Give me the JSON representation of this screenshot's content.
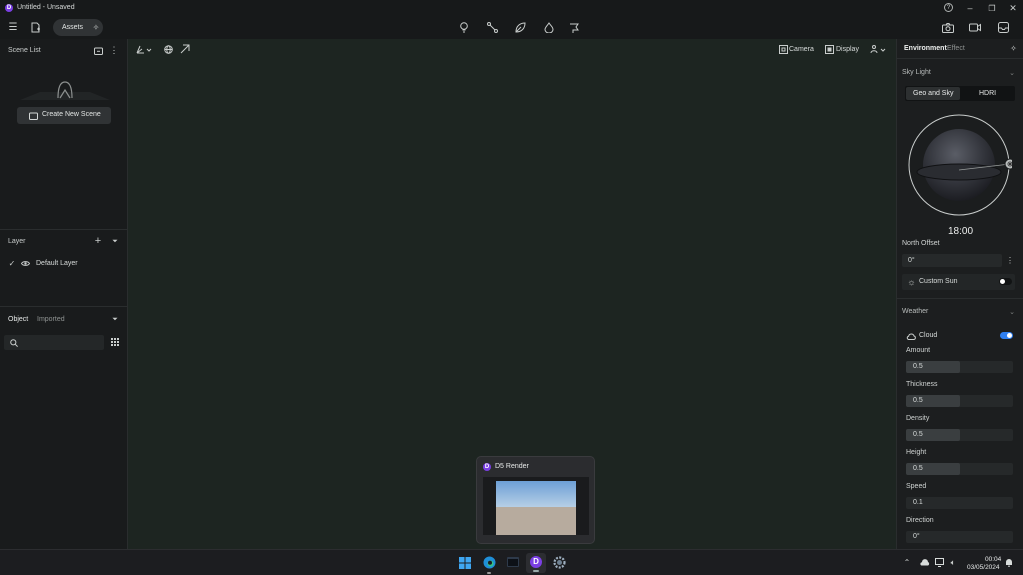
{
  "window": {
    "title": "Untitled - Unsaved"
  },
  "toolbar": {
    "assets_label": "Assets"
  },
  "scene_list": {
    "title": "Scene List",
    "create_button": "Create New Scene"
  },
  "layer": {
    "title": "Layer",
    "items": [
      {
        "label": "Default Layer"
      }
    ]
  },
  "object_panel": {
    "tabs": [
      "Object",
      "Imported"
    ],
    "search_placeholder": ""
  },
  "viewport_bar": {
    "camera_label": "Camera",
    "display_label": "Display"
  },
  "right_panel": {
    "tabs": [
      "Environment",
      "Effect"
    ],
    "sky_light": {
      "title": "Sky Light",
      "modes": [
        "Geo and Sky",
        "HDRI"
      ],
      "time": "18:00",
      "north_offset_label": "North Offset",
      "north_offset_value": "0°",
      "custom_sun_label": "Custom Sun",
      "custom_sun_enabled": false
    },
    "weather": {
      "title": "Weather",
      "cloud_label": "Cloud",
      "cloud_enabled": true,
      "params": [
        {
          "label": "Amount",
          "value": "0.5",
          "fraction": 0.5
        },
        {
          "label": "Thickness",
          "value": "0.5",
          "fraction": 0.5
        },
        {
          "label": "Density",
          "value": "0.5",
          "fraction": 0.5
        },
        {
          "label": "Height",
          "value": "0.5",
          "fraction": 0.5
        },
        {
          "label": "Speed",
          "value": "0.1",
          "fraction": 0.0
        },
        {
          "label": "Direction",
          "value": "0°",
          "fraction": 0.0
        }
      ]
    }
  },
  "taskbar_preview": {
    "title": "D5 Render"
  },
  "clock": {
    "time": "00:04",
    "date": "03/05/2024"
  },
  "colors": {
    "accent": "#2f7ff0",
    "viewport": "#1d2521",
    "panel": "#191b1c",
    "app_icon": "#7b3fe4"
  }
}
